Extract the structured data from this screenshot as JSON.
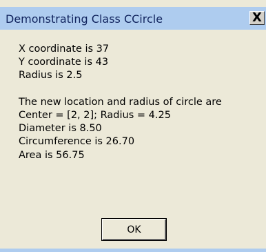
{
  "window": {
    "title": "Demonstrating Class CCircle",
    "close_glyph": "X"
  },
  "message": {
    "lines": [
      "X coordinate is 37",
      "Y coordinate is 43",
      "Radius is 2.5",
      "",
      "The new location and radius of circle are",
      "Center = [2, 2]; Radius = 4.25",
      "Diameter is 8.50",
      "Circumference is 26.70",
      "Area is 56.75"
    ]
  },
  "buttons": {
    "ok_label": "OK"
  },
  "colors": {
    "titlebar": "#aeccef",
    "title_text": "#11245e",
    "dialog_bg": "#ece9d8"
  },
  "icons": {
    "close": "close-icon"
  }
}
